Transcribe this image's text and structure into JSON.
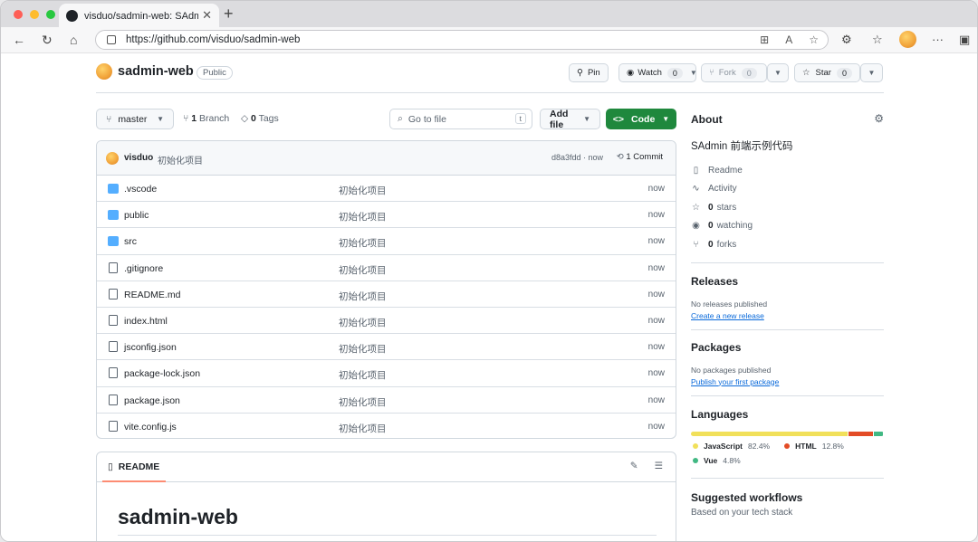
{
  "browser": {
    "tab_title": "visduo/sadmin-web: SAdmin 前",
    "url": "https://github.com/visduo/sadmin-web"
  },
  "repo": {
    "name": "sadmin-web",
    "visibility": "Public",
    "pin": "Pin",
    "watch": "Watch",
    "watch_count": "0",
    "fork": "Fork",
    "fork_count": "0",
    "star": "Star",
    "star_count": "0"
  },
  "filebar": {
    "branch": "master",
    "branch_count": "1",
    "branch_label": "Branch",
    "tag_count": "0",
    "tag_label": "Tags",
    "goto_placeholder": "Go to file",
    "goto_key": "t",
    "add_file": "Add file",
    "code": "Code"
  },
  "commit": {
    "user": "visduo",
    "message": "初始化项目",
    "hash_time": "d8a3fdd · now",
    "count": "1 Commit"
  },
  "files": [
    {
      "name": ".vscode",
      "type": "folder",
      "msg": "初始化项目",
      "time": "now"
    },
    {
      "name": "public",
      "type": "folder",
      "msg": "初始化项目",
      "time": "now"
    },
    {
      "name": "src",
      "type": "folder",
      "msg": "初始化项目",
      "time": "now"
    },
    {
      "name": ".gitignore",
      "type": "file",
      "msg": "初始化项目",
      "time": "now"
    },
    {
      "name": "README.md",
      "type": "file",
      "msg": "初始化项目",
      "time": "now"
    },
    {
      "name": "index.html",
      "type": "file",
      "msg": "初始化项目",
      "time": "now"
    },
    {
      "name": "jsconfig.json",
      "type": "file",
      "msg": "初始化项目",
      "time": "now"
    },
    {
      "name": "package-lock.json",
      "type": "file",
      "msg": "初始化项目",
      "time": "now"
    },
    {
      "name": "package.json",
      "type": "file",
      "msg": "初始化项目",
      "time": "now"
    },
    {
      "name": "vite.config.js",
      "type": "file",
      "msg": "初始化项目",
      "time": "now"
    }
  ],
  "readme": {
    "tab": "README",
    "title": "sadmin-web"
  },
  "about": {
    "heading": "About",
    "description": "SAdmin 前端示例代码",
    "readme": "Readme",
    "activity": "Activity",
    "stars_count": "0",
    "stars_label": "stars",
    "watching_count": "0",
    "watching_label": "watching",
    "forks_count": "0",
    "forks_label": "forks"
  },
  "releases": {
    "heading": "Releases",
    "empty": "No releases published",
    "link": "Create a new release"
  },
  "packages": {
    "heading": "Packages",
    "empty": "No packages published",
    "link": "Publish your first package"
  },
  "languages": {
    "heading": "Languages",
    "items": [
      {
        "name": "JavaScript",
        "percent": "82.4%",
        "value": 82.4,
        "color": "#f1e05a"
      },
      {
        "name": "HTML",
        "percent": "12.8%",
        "value": 12.8,
        "color": "#e34c26"
      },
      {
        "name": "Vue",
        "percent": "4.8%",
        "value": 4.8,
        "color": "#41b883"
      }
    ]
  },
  "workflows": {
    "heading": "Suggested workflows",
    "sub": "Based on your tech stack"
  }
}
